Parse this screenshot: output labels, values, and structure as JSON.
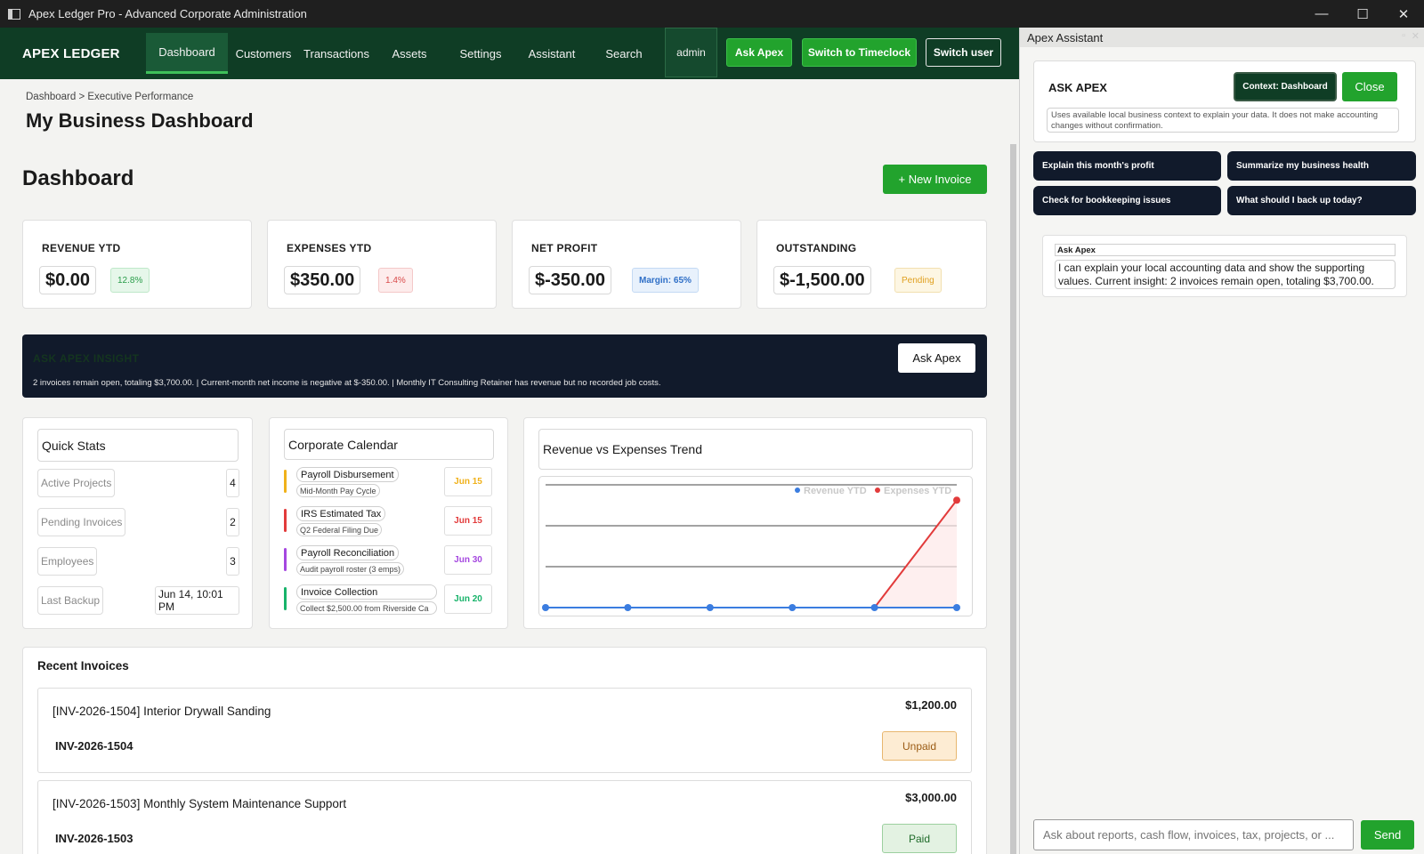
{
  "window": {
    "title": "Apex Ledger Pro - Advanced Corporate Administration",
    "minimize": "—",
    "maximize": "☐",
    "close": "✕"
  },
  "nav": {
    "brand": "APEX LEDGER",
    "tabs": [
      "Dashboard",
      "Customers",
      "Transactions",
      "Assets",
      "Settings",
      "Assistant",
      "Search"
    ],
    "user": "admin",
    "ask_apex": "Ask Apex",
    "switch_timeclock": "Switch to Timeclock",
    "switch_user": "Switch user"
  },
  "page": {
    "breadcrumb": "Dashboard  >  Executive Performance",
    "title": "My Business Dashboard",
    "section": "Dashboard",
    "new_invoice": "+ New Invoice"
  },
  "kpis": [
    {
      "label": "REVENUE YTD",
      "value": "$0.00",
      "badge": "12.8%"
    },
    {
      "label": "EXPENSES YTD",
      "value": "$350.00",
      "badge": "1.4%"
    },
    {
      "label": "NET PROFIT",
      "value": "$-350.00",
      "badge": "Margin: 65%"
    },
    {
      "label": "OUTSTANDING",
      "value": "$-1,500.00",
      "badge": "Pending"
    }
  ],
  "insight": {
    "title": "ASK APEX INSIGHT",
    "text": "2 invoices remain open, totaling $3,700.00.  |  Current-month net income is negative at $-350.00.  |  Monthly IT Consulting Retainer has revenue but no recorded job costs.",
    "button": "Ask Apex"
  },
  "quick_stats": {
    "title": "Quick Stats",
    "rows": [
      {
        "label": "Active Projects",
        "value": "4"
      },
      {
        "label": "Pending Invoices",
        "value": "2"
      },
      {
        "label": "Employees",
        "value": "3"
      },
      {
        "label": "Last Backup",
        "value": "Jun 14, 10:01 PM"
      }
    ]
  },
  "calendar": {
    "title": "Corporate Calendar",
    "events": [
      {
        "title": "Payroll Disbursement",
        "sub": "Mid-Month Pay Cycle",
        "date": "Jun 15",
        "color": "#f0b11a"
      },
      {
        "title": "IRS Estimated Tax",
        "sub": "Q2 Federal Filing Due",
        "date": "Jun 15",
        "color": "#e23b3b"
      },
      {
        "title": "Payroll Reconciliation",
        "sub": "Audit payroll roster (3 emps)",
        "date": "Jun 30",
        "color": "#a548e0"
      },
      {
        "title": "Invoice Collection",
        "sub": "Collect $2,500.00 from Riverside Ca",
        "date": "Jun 20",
        "color": "#17b36a"
      }
    ]
  },
  "trend": {
    "title": "Revenue vs Expenses Trend"
  },
  "chart_data": {
    "type": "line",
    "title": "Revenue vs Expenses Trend",
    "x": [
      1,
      2,
      3,
      4,
      5,
      6
    ],
    "series": [
      {
        "name": "Revenue YTD",
        "values": [
          0,
          0,
          0,
          0,
          0,
          0
        ],
        "color": "#3b7de0"
      },
      {
        "name": "Expenses YTD",
        "values": [
          0,
          0,
          0,
          0,
          0,
          350
        ],
        "color": "#e23b3b"
      }
    ],
    "ylim": [
      0,
      400
    ],
    "legend": "top-right",
    "grid": true
  },
  "recent": {
    "title": "Recent Invoices",
    "invoices": [
      {
        "title": "[INV-2026-1504] Interior Drywall Sanding",
        "number": "INV-2026-1504",
        "amount": "$1,200.00",
        "status": "Unpaid"
      },
      {
        "title": "[INV-2026-1503] Monthly System Maintenance Support",
        "number": "INV-2026-1503",
        "amount": "$3,000.00",
        "status": "Paid"
      }
    ]
  },
  "assistant": {
    "panel_title": "Apex Assistant",
    "heading": "ASK APEX",
    "context_button": "Context: Dashboard",
    "close_button": "Close",
    "description": "Uses available local business context to explain your data. It does not make accounting changes without confirmation.",
    "chips": [
      "Explain this month's profit",
      "Summarize my business health",
      "Check for bookkeeping issues",
      "What should I back up today?"
    ],
    "message_author": "Ask Apex",
    "message_text": "I can explain your local accounting data and show the supporting values. Current insight: 2 invoices remain open, totaling $3,700.00.",
    "input_placeholder": "Ask about reports, cash flow, invoices, tax, projects, or ...",
    "send": "Send"
  }
}
